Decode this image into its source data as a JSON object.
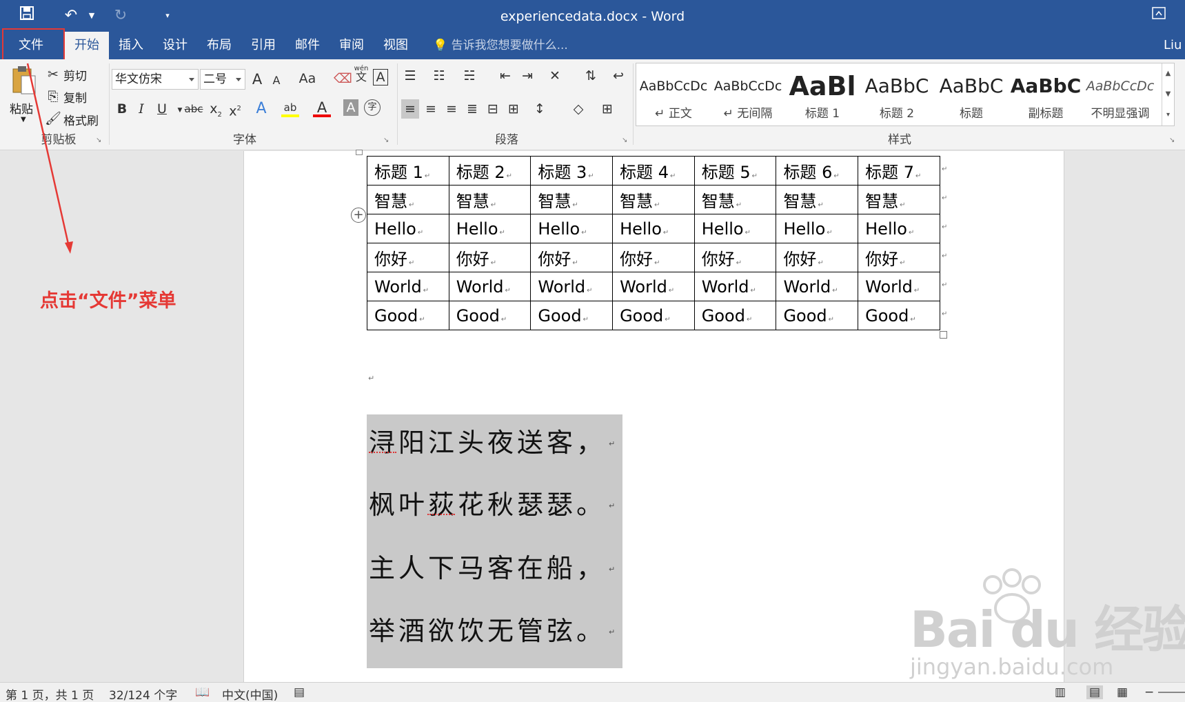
{
  "window": {
    "title": "experiencedata.docx - Word",
    "user_partial": "Liu"
  },
  "tabs": [
    {
      "label": "文件"
    },
    {
      "label": "开始"
    },
    {
      "label": "插入"
    },
    {
      "label": "设计"
    },
    {
      "label": "布局"
    },
    {
      "label": "引用"
    },
    {
      "label": "邮件"
    },
    {
      "label": "审阅"
    },
    {
      "label": "视图"
    }
  ],
  "tell_me": {
    "placeholder": "告诉我您想要做什么..."
  },
  "clipboard": {
    "paste": "粘贴",
    "cut": "剪切",
    "copy": "复制",
    "format_painter": "格式刷",
    "group": "剪贴板"
  },
  "font": {
    "name": "华文仿宋",
    "size": "二号",
    "group": "字体",
    "grow": "A",
    "shrink": "A",
    "case": "Aa",
    "phonetic_top": "wén",
    "phonetic_bottom": "文",
    "border_char": "A",
    "bold": "B",
    "italic": "I",
    "underline": "U",
    "strike": "abc",
    "sub": "x",
    "sub_mark": "2",
    "sup": "x",
    "sup_mark": "2",
    "effects": "A",
    "highlight": "ab",
    "color": "A",
    "shade": "A",
    "enclose": "字"
  },
  "paragraph": {
    "group": "段落"
  },
  "styles": {
    "group": "样式",
    "items": [
      {
        "sample": "AaBbCcDc",
        "name": "↵ 正文"
      },
      {
        "sample": "AaBbCcDc",
        "name": "↵ 无间隔"
      },
      {
        "sample": "AaBl",
        "name": "标题 1"
      },
      {
        "sample": "AaBbC",
        "name": "标题 2"
      },
      {
        "sample": "AaBbC",
        "name": "标题"
      },
      {
        "sample": "AaBbC",
        "name": "副标题"
      },
      {
        "sample": "AaBbCcDc",
        "name": "不明显强调"
      }
    ]
  },
  "table": {
    "rows": [
      [
        "标题 1",
        "标题 2",
        "标题 3",
        "标题 4",
        "标题 5",
        "标题 6",
        "标题 7"
      ],
      [
        "智慧",
        "智慧",
        "智慧",
        "智慧",
        "智慧",
        "智慧",
        "智慧"
      ],
      [
        "Hello",
        "Hello",
        "Hello",
        "Hello",
        "Hello",
        "Hello",
        "Hello"
      ],
      [
        "你好",
        "你好",
        "你好",
        "你好",
        "你好",
        "你好",
        "你好"
      ],
      [
        "World",
        "World",
        "World",
        "World",
        "World",
        "World",
        "World"
      ],
      [
        "Good",
        "Good",
        "Good",
        "Good",
        "Good",
        "Good",
        "Good"
      ]
    ]
  },
  "marks": {
    "para": "↵",
    "add": "+"
  },
  "poem": [
    "浔阳江头夜送客，",
    "枫叶荻花秋瑟瑟。",
    "主人下马客在船，",
    "举酒欲饮无管弦。"
  ],
  "annotation": "点击“文件”菜单",
  "watermark": {
    "text": "Bai du 经验",
    "url": "jingyan.baidu.com"
  },
  "status": {
    "page": "第 1 页，共 1 页",
    "words": "32/124 个字",
    "lang": "中文(中国)"
  },
  "colors": {
    "brand": "#2b579a",
    "annotation": "#e53935"
  }
}
